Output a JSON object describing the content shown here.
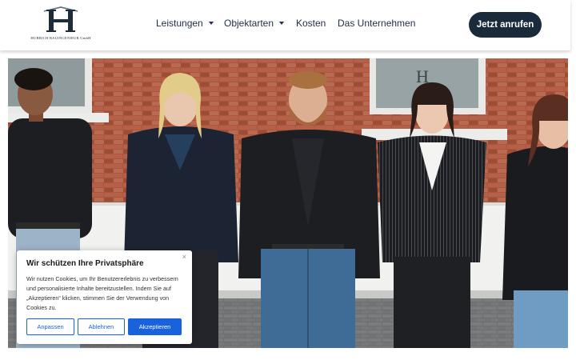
{
  "header": {
    "logo_text": "HUBRICH BAUINGENIEUR GmbH",
    "nav": [
      {
        "label": "Leistungen",
        "has_dropdown": true
      },
      {
        "label": "Objektarten",
        "has_dropdown": true
      },
      {
        "label": "Kosten",
        "has_dropdown": false
      },
      {
        "label": "Das Unternehmen",
        "has_dropdown": false
      }
    ],
    "cta_label": "Jetzt anrufen"
  },
  "hero": {
    "description_alt": "Team photo of five people in front of a brick building"
  },
  "cookie": {
    "title": "Wir schützen Ihre Privatsphäre",
    "body": "Wir nutzen Cookies, um Ihr Benutzererlebnis zu verbessern und personalisierte Inhalte bereitzustellen. Indem Sie auf „Akzeptieren“ klicken, stimmen Sie der Verwendung von Cookies zu.",
    "close_label": "×",
    "buttons": {
      "customize": "Anpassen",
      "reject": "Ablehnen",
      "accept": "Akzeptieren"
    }
  },
  "colors": {
    "brand_dark": "#1a2a3b",
    "cookie_accent": "#1863dc"
  }
}
